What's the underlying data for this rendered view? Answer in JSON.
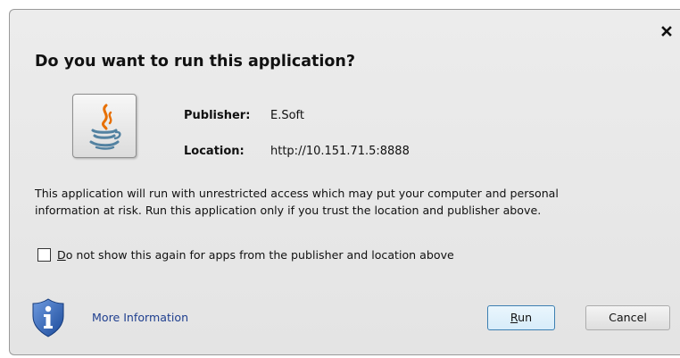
{
  "dialog": {
    "title": "Do you want to run this application?",
    "publisher_label": "Publisher:",
    "publisher_value": "E.Soft",
    "location_label": "Location:",
    "location_value": "http://10.151.71.5:8888",
    "warning_line1": "This application will run with unrestricted access which may put your computer and personal",
    "warning_line2": "information at risk. Run this application only if you trust the location and publisher above.",
    "checkbox_mnemonic": "D",
    "checkbox_rest": "o not show this again for apps from the publisher and location above",
    "checkbox_checked": false,
    "more_info_label": "More Information",
    "run_mnemonic": "R",
    "run_rest": "un",
    "cancel_label": "Cancel"
  },
  "icons": {
    "close": "close-icon",
    "app": "java-coffee-cup-icon",
    "info_shield": "info-shield-icon"
  },
  "colors": {
    "link": "#1f3f8f",
    "java_orange": "#e76f00",
    "java_blue": "#5382a1",
    "shield_blue": "#2a5fb0",
    "default_button_border": "#3c7fb1"
  }
}
